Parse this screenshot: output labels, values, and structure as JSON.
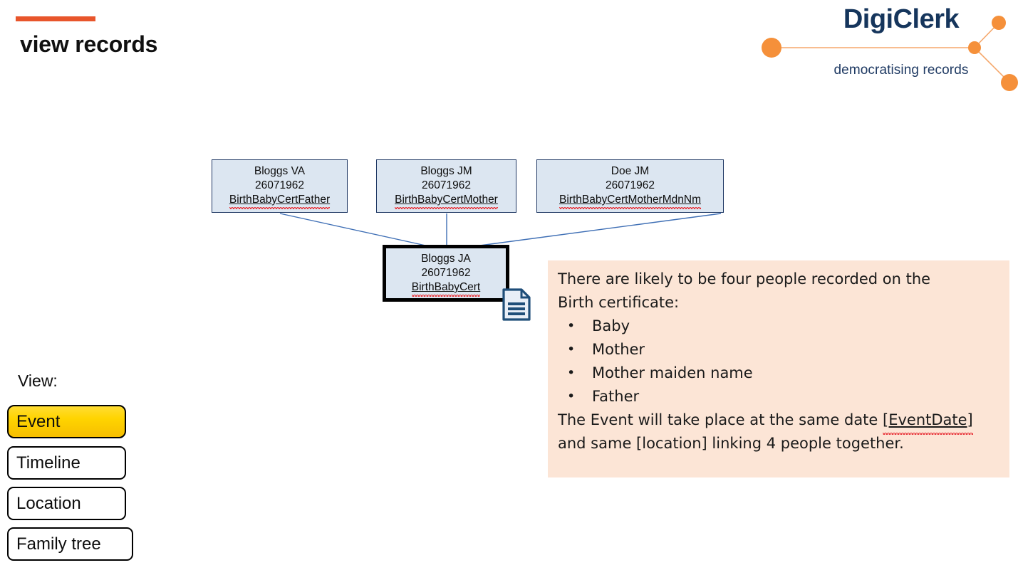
{
  "header": {
    "title": "view records",
    "accent_color": "#E8552B"
  },
  "brand": {
    "wordmark": "DigiClerk",
    "tagline": "democratising records",
    "wordmark_color": "#15355C",
    "node_color": "#F5903A"
  },
  "diagram": {
    "nodes": [
      {
        "id": "father",
        "name": "Bloggs VA",
        "date": "26071962",
        "role": "BirthBabyCertFather",
        "selected": false
      },
      {
        "id": "mother",
        "name": "Bloggs JM",
        "date": "26071962",
        "role": "BirthBabyCertMother",
        "selected": false
      },
      {
        "id": "mother_maiden",
        "name": "Doe JM",
        "date": "26071962",
        "role": "BirthBabyCertMotherMdnNm",
        "selected": false
      },
      {
        "id": "baby",
        "name": "Bloggs JA",
        "date": "26071962",
        "role": "BirthBabyCert",
        "selected": true
      }
    ],
    "node_fill": "#DCE6F1",
    "node_border": "#1F3864",
    "connector_color": "#3F6FB5",
    "document_icon": "document-icon"
  },
  "note": {
    "intro_line1": "There are likely to be four people recorded on the",
    "intro_line2": "Birth certificate:",
    "bullets": [
      "Baby",
      "Mother",
      "Mother maiden name",
      "Father"
    ],
    "outro_before": "The Event will take place at the same date ",
    "outro_token": "[EventDate]",
    "outro_after": " and same [location] linking 4 people together.",
    "background_color": "#FCE5D6"
  },
  "view_switcher": {
    "label": "View:",
    "active": "Event",
    "buttons": [
      {
        "label": "Event"
      },
      {
        "label": "Timeline"
      },
      {
        "label": "Location"
      },
      {
        "label": "Family tree"
      }
    ],
    "active_color": "#FFD400"
  }
}
